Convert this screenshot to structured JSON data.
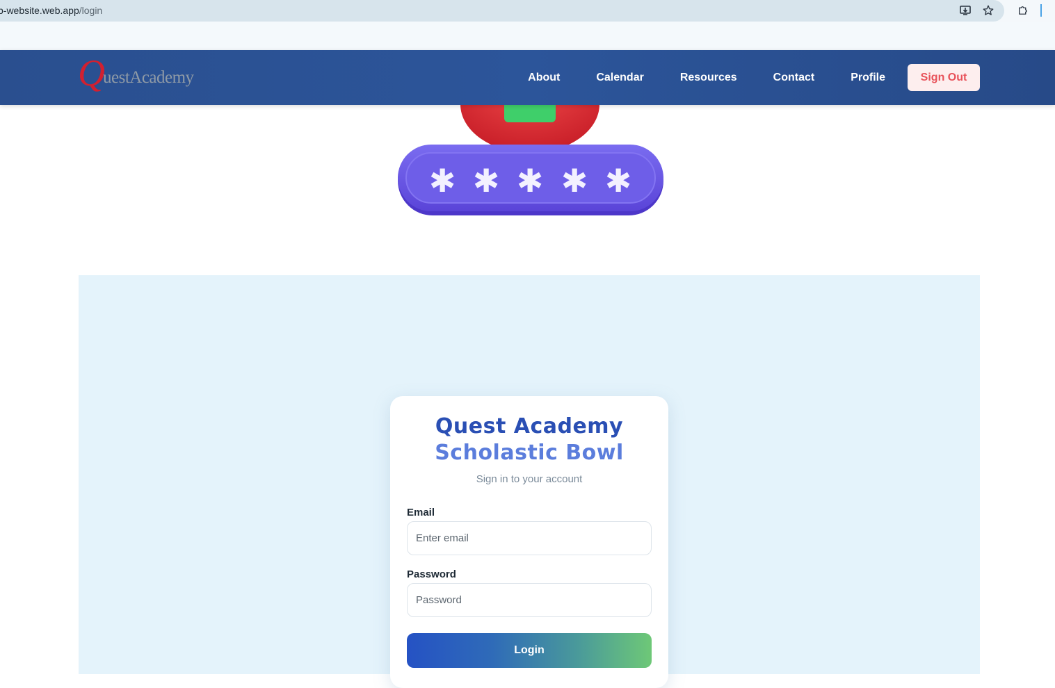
{
  "browser": {
    "url_host": "sb-website.web.app",
    "url_path": "/login",
    "icons": [
      "install-app-icon",
      "star-icon",
      "extensions-icon"
    ]
  },
  "header": {
    "logo_q": "Q",
    "logo_rest": "uestAcademy",
    "nav": [
      "About",
      "Calendar",
      "Resources",
      "Contact",
      "Profile"
    ],
    "signout_label": "Sign Out"
  },
  "login": {
    "title_line1": "Quest Academy",
    "title_line2": "Scholastic Bowl",
    "subtitle": "Sign in to your account",
    "email_label": "Email",
    "email_placeholder": "Enter email",
    "password_label": "Password",
    "password_placeholder": "Password",
    "submit_label": "Login"
  },
  "colors": {
    "nav_bg": "#2c559a",
    "title_primary": "#2a4fb4",
    "title_secondary": "#5b7ddc",
    "signout_text": "#e8525a",
    "section_bg": "#e4f3fb"
  }
}
